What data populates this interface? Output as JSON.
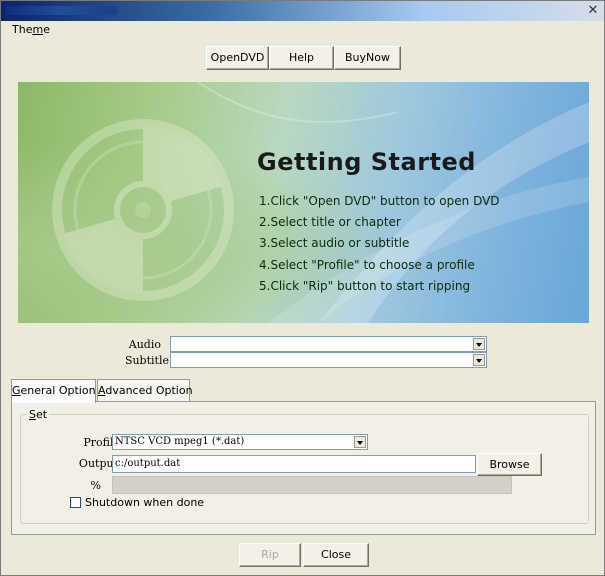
{
  "window": {
    "title": "",
    "close_glyph": "✕"
  },
  "menu": {
    "theme": {
      "prefix": "The",
      "underlined": "m",
      "suffix": "e"
    }
  },
  "toolbar": {
    "open_dvd": "OpenDVD",
    "help": "Help",
    "buy_now": "BuyNow"
  },
  "banner": {
    "title": "Getting Started",
    "steps": [
      "1.Click \"Open DVD\" button to open DVD",
      "2.Select title or chapter",
      "3.Select audio or subtitle",
      "4.Select \"Profile\" to choose a profile",
      "5.Click \"Rip\" button to start ripping"
    ]
  },
  "selectors": {
    "audio_label": "Audio",
    "audio_value": "",
    "subtitle_label": "Subtitle",
    "subtitle_value": ""
  },
  "tabs": {
    "general": {
      "underlined": "G",
      "rest": "eneral Option"
    },
    "advanced": {
      "underlined": "A",
      "rest": "dvanced Option"
    }
  },
  "group": {
    "title_underlined": "S",
    "title_rest": "et"
  },
  "form": {
    "profile_label": "Profile",
    "profile_value": "NTSC VCD mpeg1 (*.dat)",
    "output_label": "Output",
    "output_value": "c:/output.dat",
    "browse": "Browse",
    "percent_label": "%",
    "progress": 0,
    "shutdown_label": "Shutdown when done",
    "shutdown_checked": false
  },
  "footer": {
    "rip": "Rip",
    "close": "Close"
  },
  "colors": {
    "window_bg": "#ece9d8",
    "title_bar_start": "#0a246a",
    "input_border": "#7f9db9"
  },
  "icons": {
    "close": "close-icon",
    "dropdown": "chevron-down-icon",
    "disc": "disc-graphic"
  }
}
